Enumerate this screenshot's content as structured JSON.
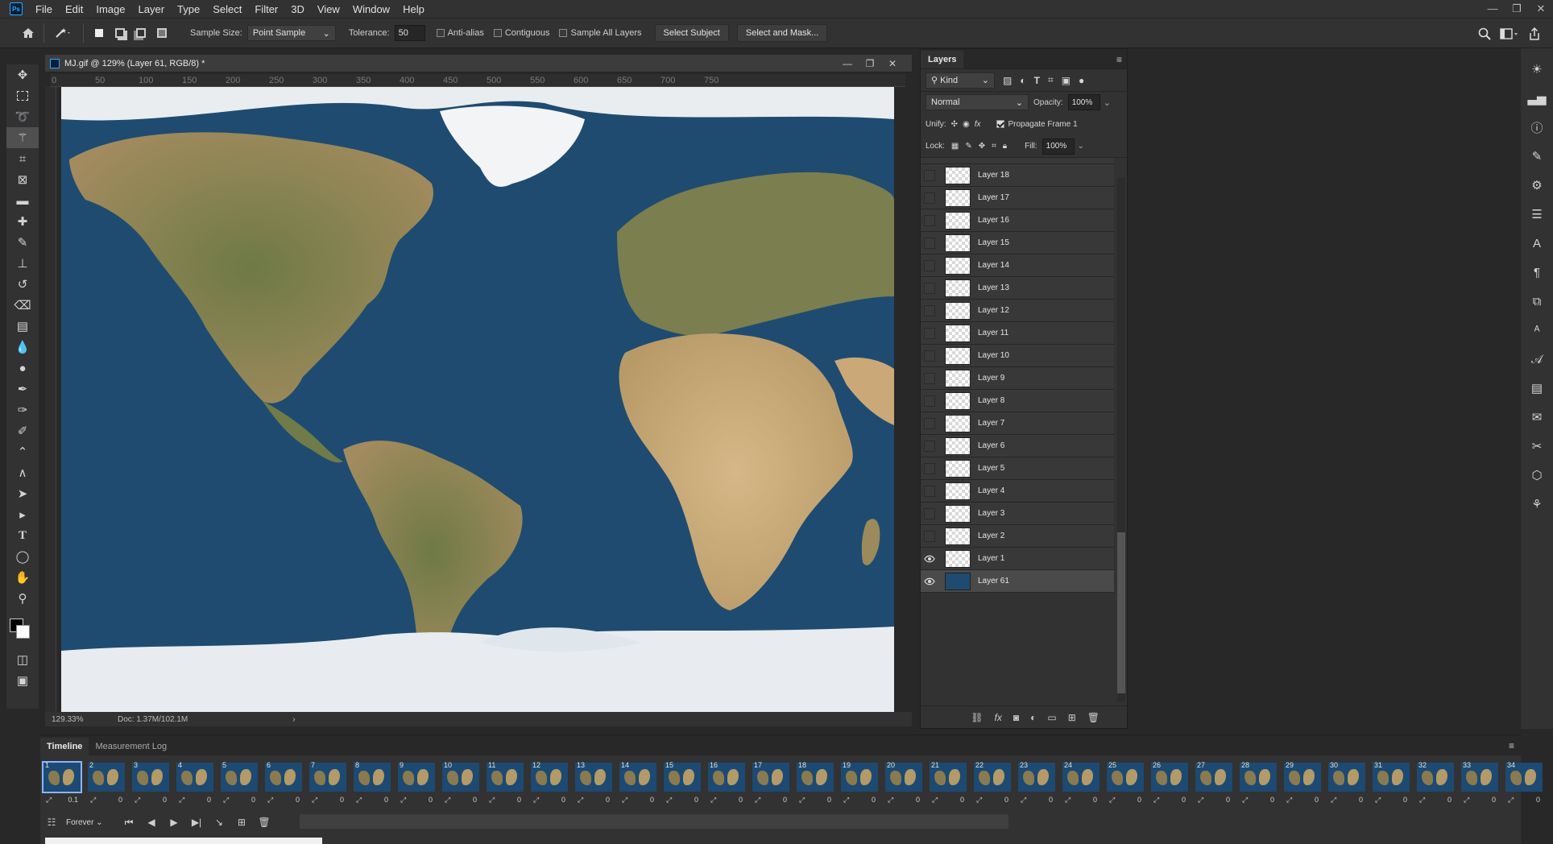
{
  "app": {
    "logo": "Ps"
  },
  "menu": [
    "File",
    "Edit",
    "Image",
    "Layer",
    "Type",
    "Select",
    "Filter",
    "3D",
    "View",
    "Window",
    "Help"
  ],
  "window_controls": {
    "minimize": "—",
    "restore": "❐",
    "close": "✕"
  },
  "options": {
    "sample_size_label": "Sample Size:",
    "sample_size_value": "Point Sample",
    "tolerance_label": "Tolerance:",
    "tolerance_value": "50",
    "antialias_label": "Anti-alias",
    "contiguous_label": "Contiguous",
    "sample_all_label": "Sample All Layers",
    "select_subject": "Select Subject",
    "select_mask": "Select and Mask..."
  },
  "document": {
    "title": "MJ.gif @ 129% (Layer 61, RGB/8) *",
    "ruler_ticks": [
      "0",
      "50",
      "100",
      "150",
      "200",
      "250",
      "300",
      "350",
      "400",
      "450",
      "500",
      "550",
      "600",
      "650",
      "700",
      "750"
    ],
    "zoom": "129.33%",
    "doc_size": "Doc: 1.37M/102.1M"
  },
  "layers_panel": {
    "tab": "Layers",
    "filter_kind": "Kind",
    "blend_mode": "Normal",
    "opacity_label": "Opacity:",
    "opacity_value": "100%",
    "unify_label": "Unify:",
    "propagate_label": "Propagate Frame 1",
    "lock_label": "Lock:",
    "fill_label": "Fill:",
    "fill_value": "100%",
    "layers": [
      {
        "name": "Layer 18",
        "visible": false
      },
      {
        "name": "Layer 17",
        "visible": false
      },
      {
        "name": "Layer 16",
        "visible": false
      },
      {
        "name": "Layer 15",
        "visible": false
      },
      {
        "name": "Layer 14",
        "visible": false
      },
      {
        "name": "Layer 13",
        "visible": false
      },
      {
        "name": "Layer 12",
        "visible": false
      },
      {
        "name": "Layer 11",
        "visible": false
      },
      {
        "name": "Layer 10",
        "visible": false
      },
      {
        "name": "Layer 9",
        "visible": false
      },
      {
        "name": "Layer 8",
        "visible": false
      },
      {
        "name": "Layer 7",
        "visible": false
      },
      {
        "name": "Layer 6",
        "visible": false
      },
      {
        "name": "Layer 5",
        "visible": false
      },
      {
        "name": "Layer 4",
        "visible": false
      },
      {
        "name": "Layer 3",
        "visible": false
      },
      {
        "name": "Layer 2",
        "visible": false
      },
      {
        "name": "Layer 1",
        "visible": true
      },
      {
        "name": "Layer 61",
        "visible": true,
        "selected": true
      }
    ]
  },
  "timeline": {
    "tabs": [
      "Timeline",
      "Measurement Log"
    ],
    "first_frame_delay": "0.1",
    "frame_delay": "0",
    "frames": [
      "1",
      "2",
      "3",
      "4",
      "5",
      "6",
      "7",
      "8",
      "9",
      "10",
      "11",
      "12",
      "13",
      "14",
      "15",
      "16",
      "17",
      "18",
      "19",
      "20",
      "21",
      "22",
      "23",
      "24",
      "25",
      "26",
      "27",
      "28",
      "29",
      "30",
      "31",
      "32",
      "33",
      "34"
    ],
    "loop": "Forever"
  },
  "colors": {
    "accent": "#31a8ff",
    "canvas_ocean": "#1c4a72",
    "panel": "#323232"
  }
}
